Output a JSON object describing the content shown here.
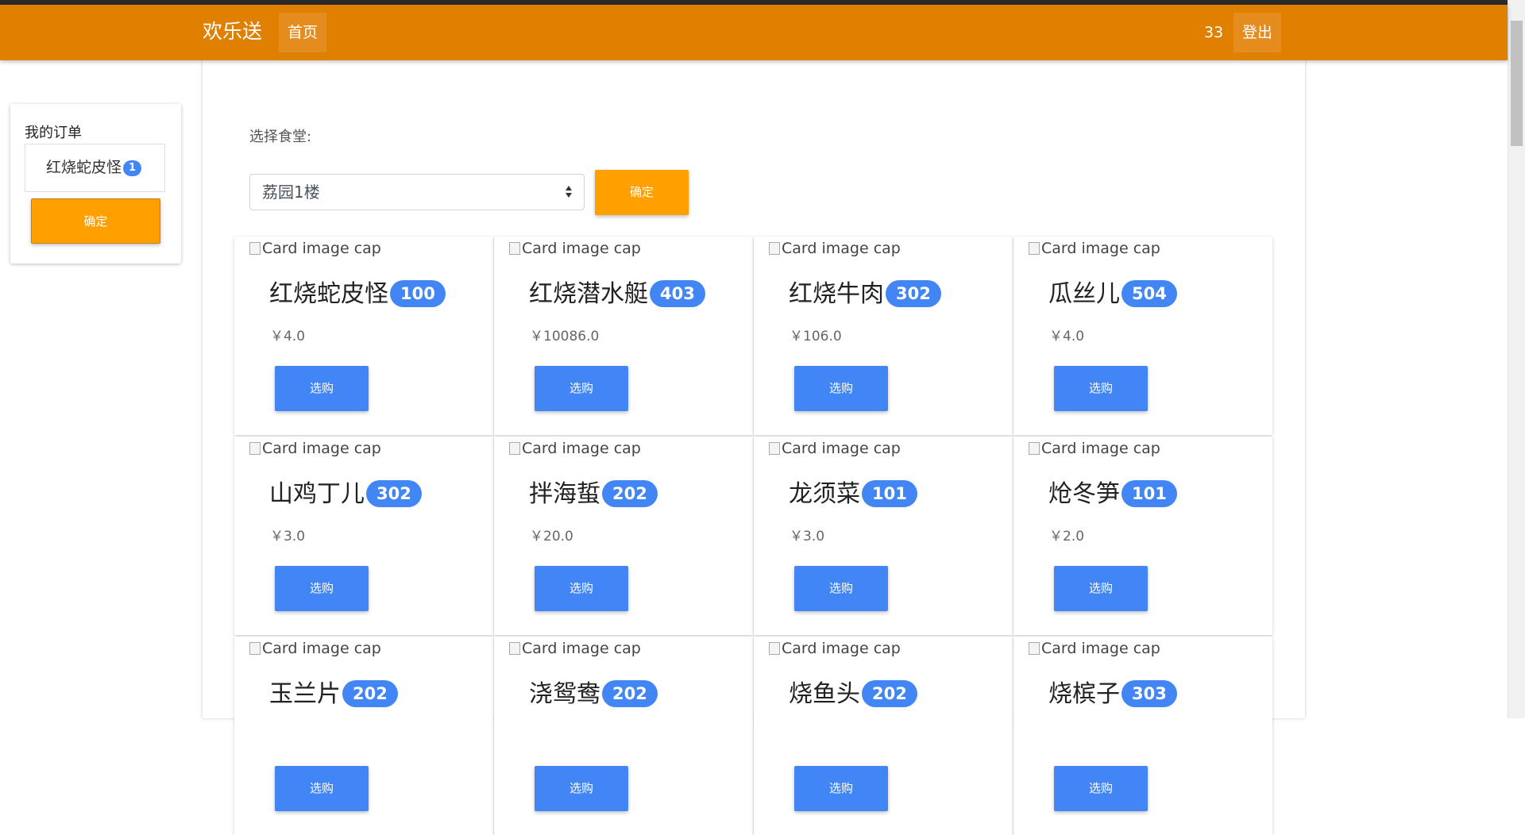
{
  "navbar": {
    "brand": "欢乐送",
    "home": "首页",
    "user": "33",
    "logout": "登出"
  },
  "sidebar": {
    "title": "我的订单",
    "order_item": "红烧蛇皮怪",
    "order_count": "1",
    "confirm": "确定"
  },
  "canteen": {
    "label": "选择食堂:",
    "selected": "荔园1楼",
    "confirm": "确定"
  },
  "card_image_alt": "Card image cap",
  "buy_label": "选购",
  "dishes": [
    {
      "name": "红烧蛇皮怪",
      "count": "100",
      "price": "￥4.0"
    },
    {
      "name": "红烧潜水艇",
      "count": "403",
      "price": "￥10086.0"
    },
    {
      "name": "红烧牛肉",
      "count": "302",
      "price": "￥106.0"
    },
    {
      "name": "瓜丝儿",
      "count": "504",
      "price": "￥4.0"
    },
    {
      "name": "山鸡丁儿",
      "count": "302",
      "price": "￥3.0"
    },
    {
      "name": "拌海蜇",
      "count": "202",
      "price": "￥20.0"
    },
    {
      "name": "龙须菜",
      "count": "101",
      "price": "￥3.0"
    },
    {
      "name": "炝冬笋",
      "count": "101",
      "price": "￥2.0"
    },
    {
      "name": "玉兰片",
      "count": "202",
      "price": ""
    },
    {
      "name": "浇鸳鸯",
      "count": "202",
      "price": ""
    },
    {
      "name": "烧鱼头",
      "count": "202",
      "price": ""
    },
    {
      "name": "烧槟子",
      "count": "303",
      "price": ""
    }
  ]
}
